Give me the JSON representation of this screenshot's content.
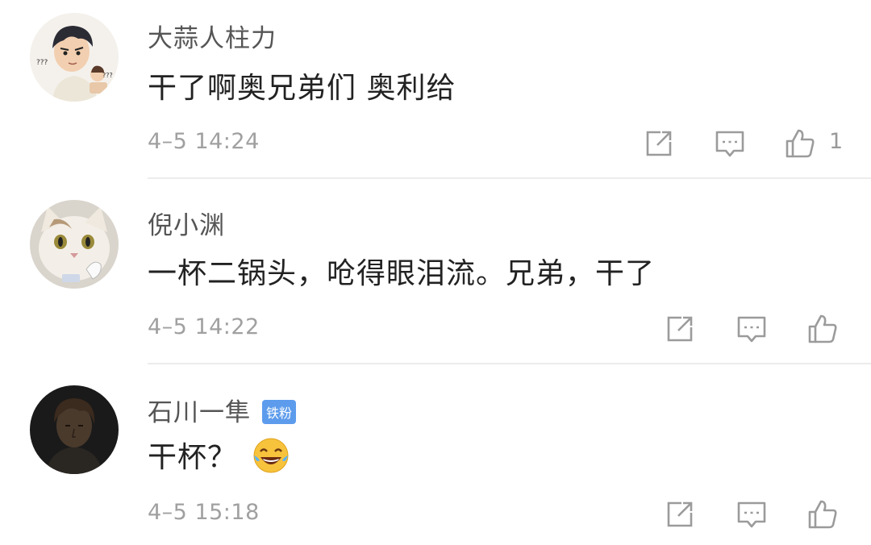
{
  "comments": [
    {
      "username": "大蒜人柱力",
      "text": "干了啊奥兄弟们 奥利给",
      "time": "4–5 14:24",
      "like_count": "1",
      "avatar_marks": [
        "???",
        "???"
      ]
    },
    {
      "username": "倪小渊",
      "text": "一杯二锅头，呛得眼泪流。兄弟，干了",
      "time": "4–5 14:22"
    },
    {
      "username": "石川一隼",
      "badge": "铁粉",
      "text": "干杯？",
      "emoji": "laughing-tears-emoji",
      "time": "4–5 15:18"
    }
  ],
  "icons": {
    "share": "share-icon",
    "reply": "comment-icon",
    "like": "thumbs-up-icon"
  },
  "colors": {
    "username": "#555555",
    "text": "#222222",
    "time": "#a0a0a0",
    "icon": "#9b9b9b",
    "badge": "#5d9cec",
    "divider": "#ececec"
  }
}
